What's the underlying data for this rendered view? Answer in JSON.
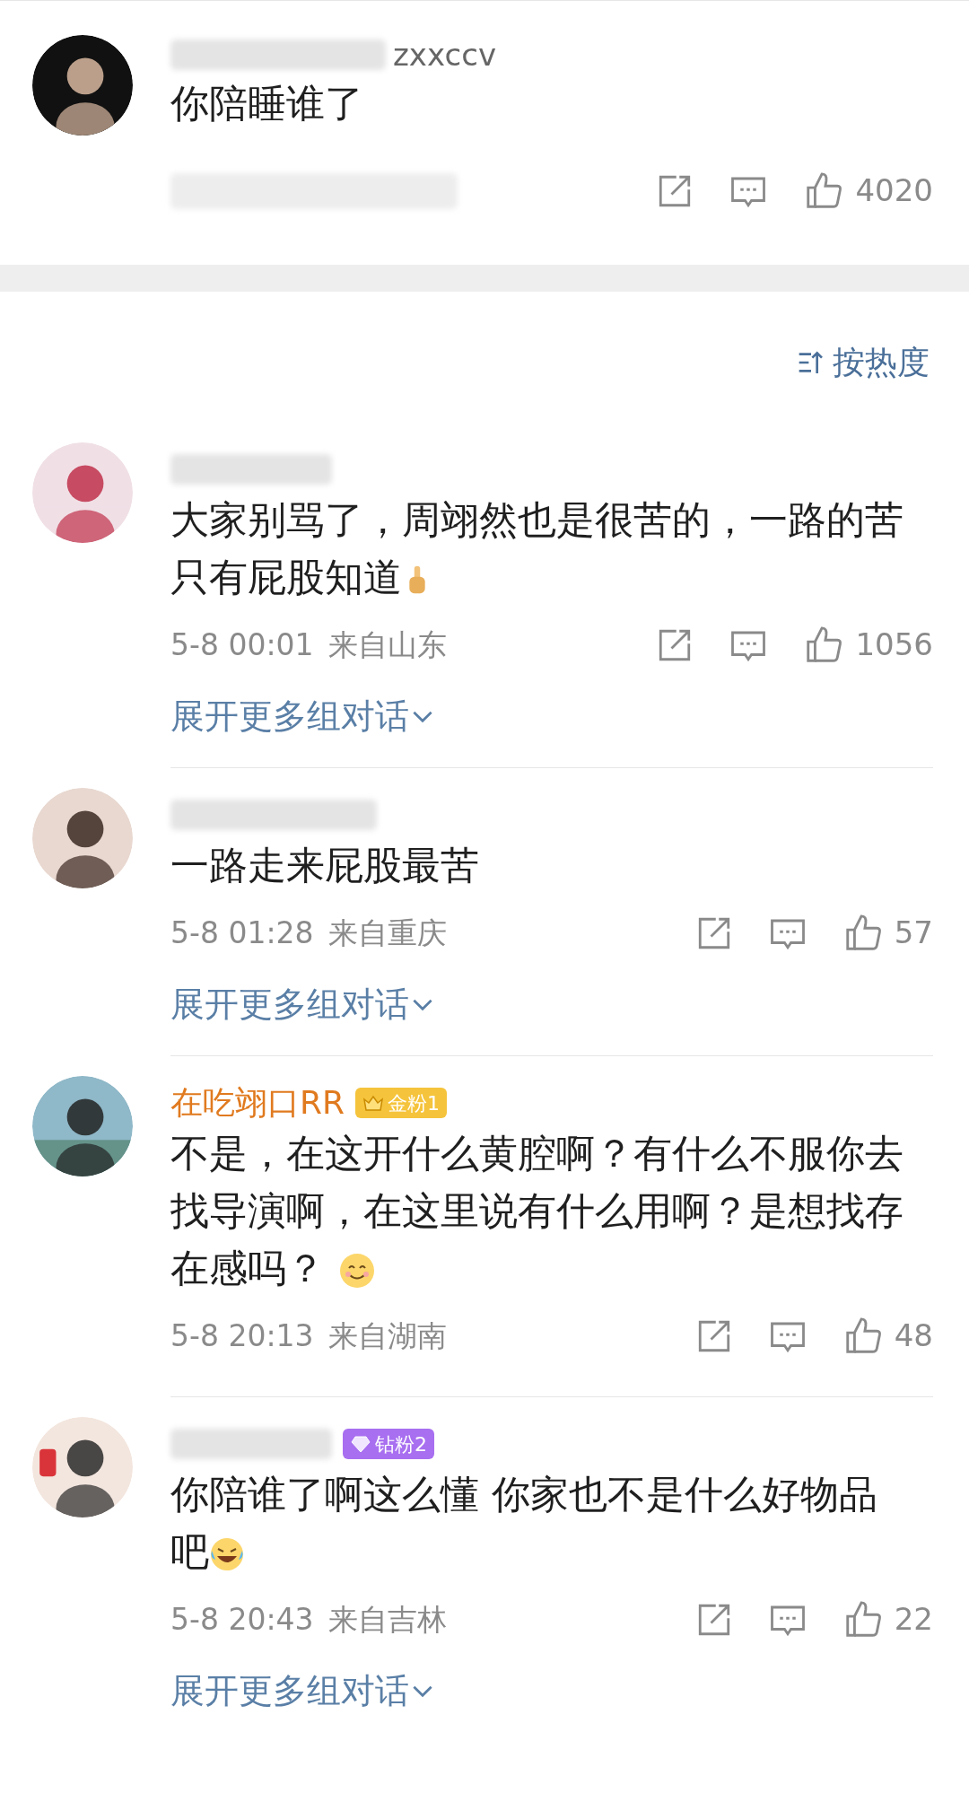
{
  "top_comment": {
    "name_blurred": true,
    "name": "zxxccv",
    "text": "你陪睡谁了",
    "footer_blurred": true,
    "likes": "4020"
  },
  "sort": {
    "label": "按热度"
  },
  "comments": [
    {
      "name_blurred": true,
      "text": "大家别骂了，周翊然也是很苦的，一路的苦只有屁股知道",
      "emoji": {
        "kind": "thumbs-up"
      },
      "time": "5-8 00:01",
      "location": "来自山东",
      "likes": "1056",
      "expand": "展开更多组对话"
    },
    {
      "name_blurred": true,
      "text": "一路走来屁股最苦",
      "time": "5-8 01:28",
      "location": "来自重庆",
      "likes": "57",
      "expand": "展开更多组对话"
    },
    {
      "name_blurred": false,
      "name": {
        "text": "在吃翊口RR",
        "color": "#e07a1f"
      },
      "badge": {
        "kind": "gold",
        "label": "金粉1"
      },
      "text": "不是，在这开什么黄腔啊？有什么不服你去找导演啊，在这里说有什么用啊？是想找存在感吗？",
      "emoji": {
        "kind": "smile"
      },
      "time": "5-8 20:13",
      "location": "来自湖南",
      "likes": "48"
    },
    {
      "name_blurred": true,
      "badge": {
        "kind": "diamond",
        "label": "钻粉2"
      },
      "text": "你陪谁了啊这么懂 你家也不是什么好物品吧",
      "emoji": {
        "kind": "laugh-cry"
      },
      "time": "5-8 20:43",
      "location": "来自吉林",
      "likes": "22",
      "expand": "展开更多组对话"
    }
  ]
}
